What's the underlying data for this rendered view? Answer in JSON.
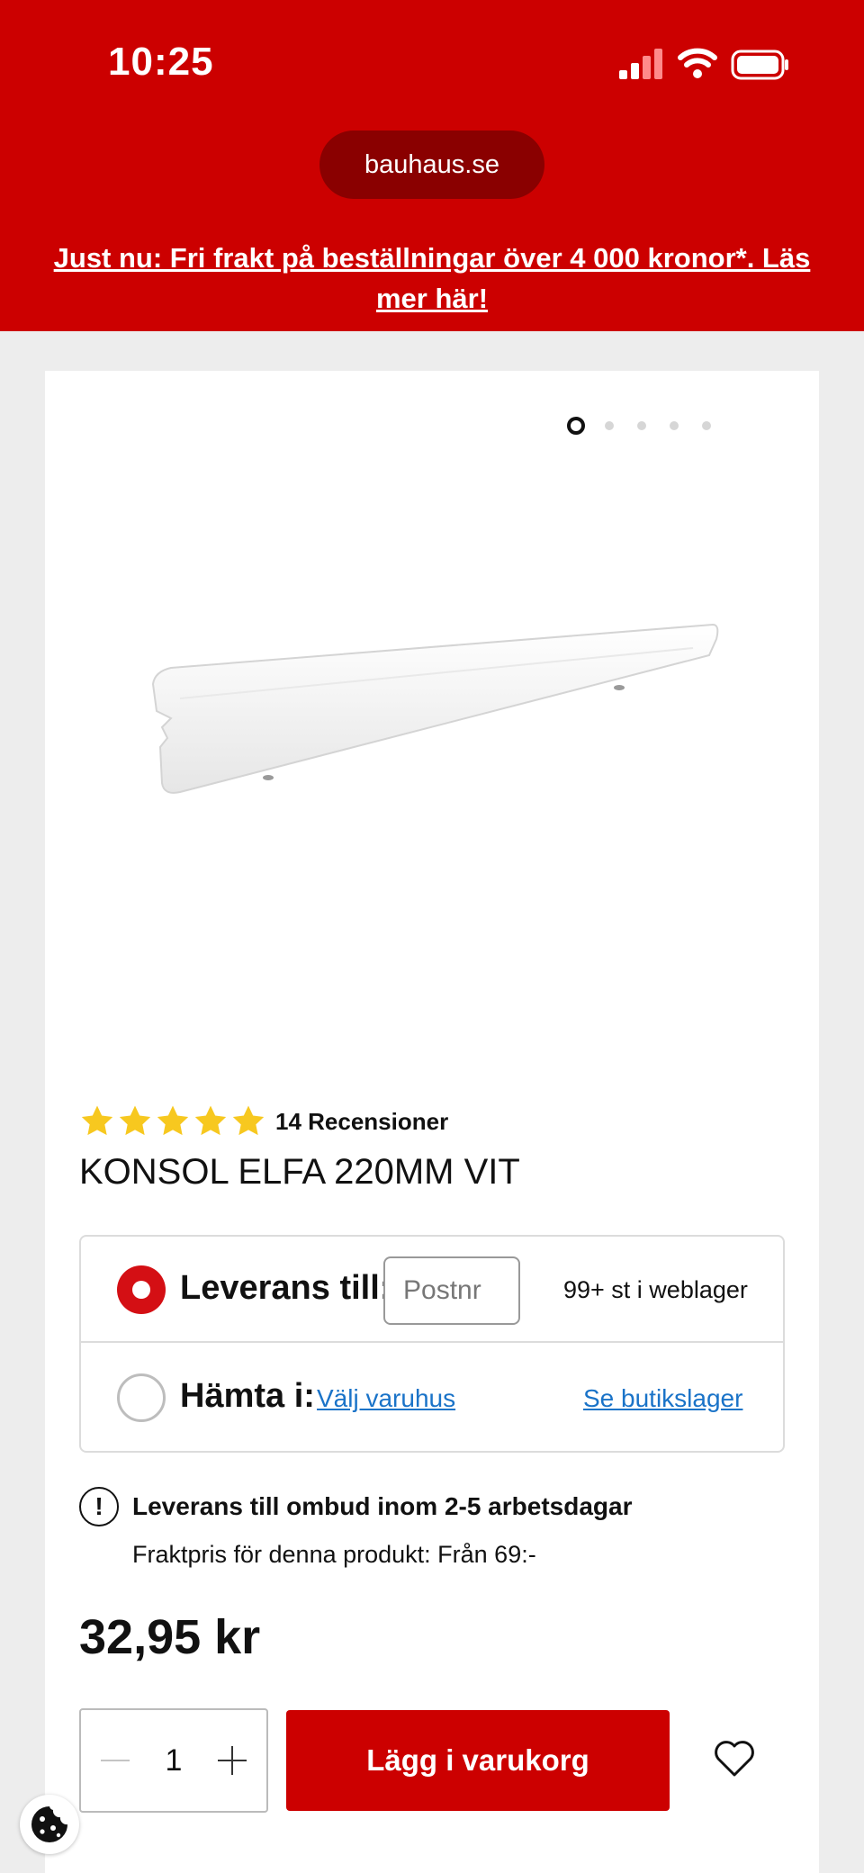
{
  "status_bar": {
    "time": "10:25"
  },
  "browser": {
    "url": "bauhaus.se"
  },
  "promo_banner": {
    "text": "Just nu: Fri frakt på beställningar över 4 000 kronor*. Läs mer här!"
  },
  "gallery": {
    "image_count": 5,
    "active_index": 0
  },
  "product": {
    "rating": 5,
    "review_count_label": "14 Recensioner",
    "title": "KONSOL ELFA 220MM VIT",
    "price": "32,95 kr"
  },
  "delivery": {
    "delivery_label": "Leverans till:",
    "postnr_placeholder": "Postnr",
    "stock_text": "99+ st i weblager",
    "pickup_label": "Hämta i:",
    "choose_store_link": "Välj varuhus",
    "store_stock_link": "Se butikslager"
  },
  "shipping_info": {
    "icon": "!",
    "title": "Leverans till ombud inom 2-5 arbetsdagar",
    "subtitle": "Fraktpris för denna produkt: Från 69:-"
  },
  "cart": {
    "quantity": "1",
    "add_label": "Lägg i varukorg"
  },
  "colors": {
    "brand_red": "#cc0000",
    "star_yellow": "#f7c81f",
    "link_blue": "#1a73c8"
  }
}
